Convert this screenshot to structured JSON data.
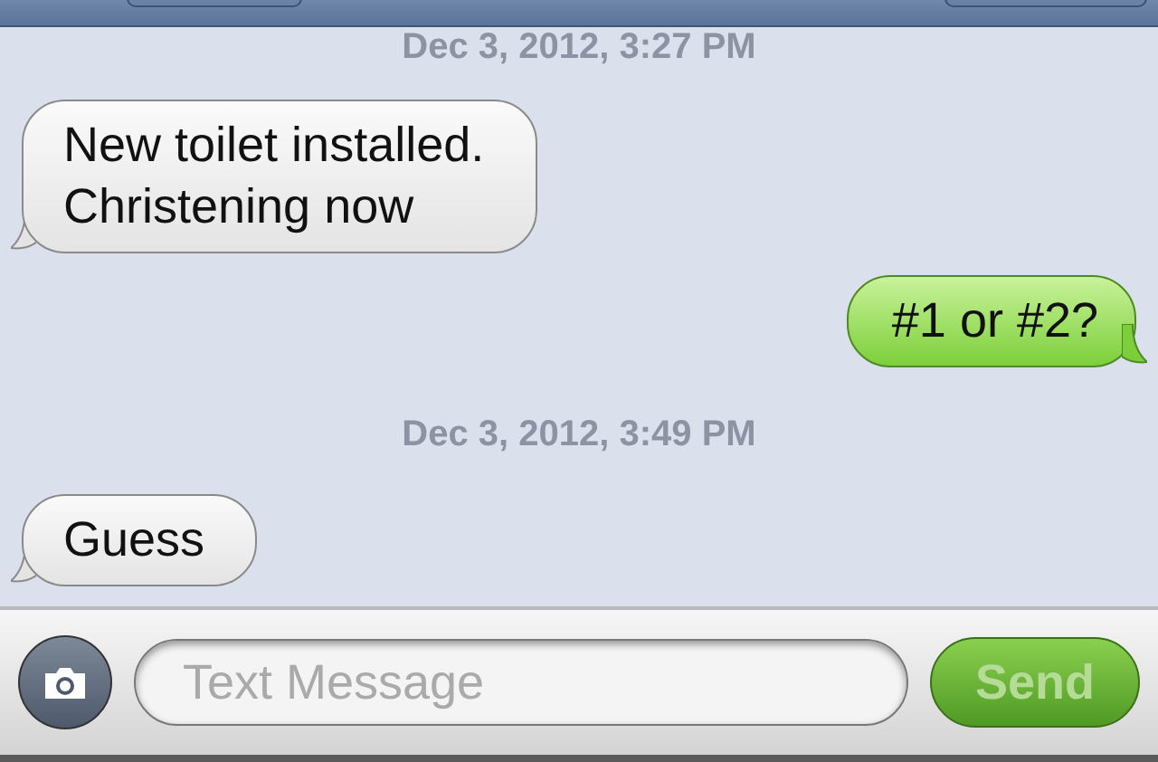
{
  "messages": [
    {
      "kind": "timestamp",
      "text": "Dec 3, 2012, 3:27 PM"
    },
    {
      "kind": "incoming",
      "lines": [
        "New toilet installed.",
        "Christening now"
      ]
    },
    {
      "kind": "outgoing",
      "lines": [
        "#1 or #2?"
      ]
    },
    {
      "kind": "timestamp",
      "text": "Dec 3, 2012, 3:49 PM"
    },
    {
      "kind": "incoming",
      "lines": [
        "Guess"
      ]
    }
  ],
  "compose": {
    "placeholder": "Text Message",
    "send_label": "Send"
  }
}
